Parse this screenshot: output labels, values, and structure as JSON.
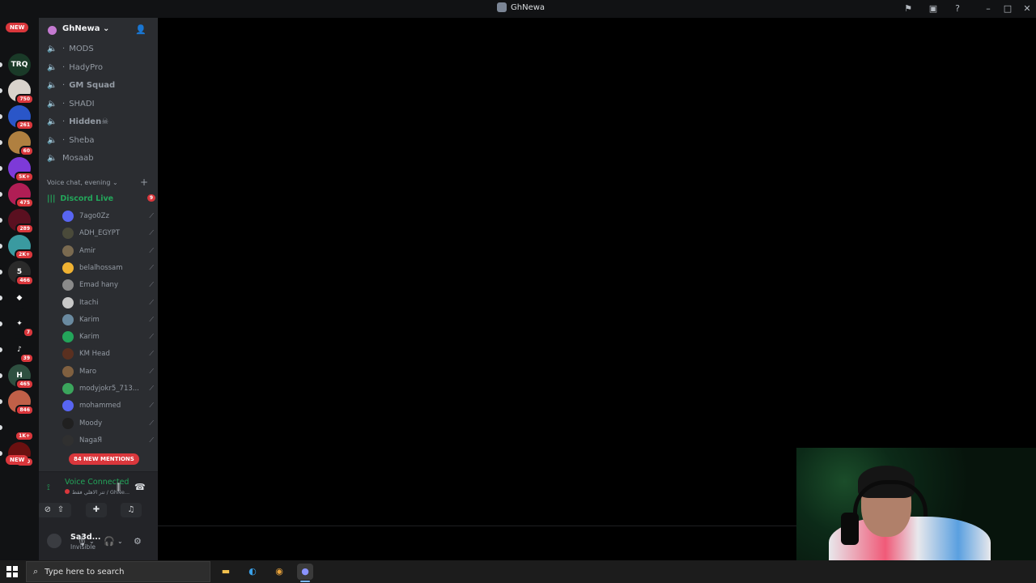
{
  "window": {
    "title": "GhNewa"
  },
  "rail": {
    "new_top": "NEW",
    "new_bottom": "NEW",
    "servers": [
      {
        "badge": "",
        "color": "#1a3a28",
        "glyph": "TRQ"
      },
      {
        "badge": "750",
        "color": "#d9d3cc",
        "glyph": ""
      },
      {
        "badge": "261",
        "color": "#2a56c8",
        "glyph": ""
      },
      {
        "badge": "60",
        "color": "#b08040",
        "glyph": ""
      },
      {
        "badge": "5K+",
        "color": "#7d3ad8",
        "glyph": ""
      },
      {
        "badge": "475",
        "color": "#b01e55",
        "glyph": ""
      },
      {
        "badge": "289",
        "color": "#5a1020",
        "glyph": ""
      },
      {
        "badge": "2K+",
        "color": "#3a9aa0",
        "glyph": ""
      },
      {
        "badge": "466",
        "color": "#2a2a2a",
        "glyph": "5"
      },
      {
        "badge": "",
        "color": "#111214",
        "glyph": "◆"
      },
      {
        "badge": "7",
        "color": "#111214",
        "glyph": "✦"
      },
      {
        "badge": "39",
        "color": "#111214",
        "glyph": "♪"
      },
      {
        "badge": "465",
        "color": "#2e5040",
        "glyph": "H"
      },
      {
        "badge": "846",
        "color": "#c06048",
        "glyph": ""
      },
      {
        "badge": "1K+",
        "color": "#111214",
        "glyph": ""
      },
      {
        "badge": "810",
        "color": "#6a1010",
        "glyph": ""
      }
    ]
  },
  "guild": {
    "name": "GhNewa"
  },
  "channels": [
    {
      "name": "MODS",
      "dot": true
    },
    {
      "name": "HadyPro",
      "dot": true
    },
    {
      "name": "GM Squad",
      "dot": true
    },
    {
      "name": "SHADI",
      "dot": true
    },
    {
      "name": "Hidden☠",
      "dot": true
    },
    {
      "name": "Sheba",
      "dot": true
    },
    {
      "name": "Mosaab",
      "dot": false
    }
  ],
  "category": {
    "name": "Voice chat, evening"
  },
  "live_channel": {
    "name": "Discord Live",
    "badge": "9"
  },
  "members": [
    {
      "name": "7ago0Zz",
      "color": "#5865f2"
    },
    {
      "name": "ADH_EGYPT",
      "color": "#4a4a3a"
    },
    {
      "name": "Amir",
      "color": "#7a6a50"
    },
    {
      "name": "belalhossam",
      "color": "#f0b232"
    },
    {
      "name": "Emad hany",
      "color": "#8a8a8a"
    },
    {
      "name": "Itachi",
      "color": "#c8c8c8"
    },
    {
      "name": "Karim",
      "color": "#6a8aa0"
    },
    {
      "name": "Karim",
      "color": "#23a55a"
    },
    {
      "name": "KM Head",
      "color": "#5a3020"
    },
    {
      "name": "Maro",
      "color": "#806040"
    },
    {
      "name": "modyjokr5_713...",
      "color": "#3ba55c"
    },
    {
      "name": "mohammed",
      "color": "#5865f2"
    },
    {
      "name": "Moody",
      "color": "#202020"
    },
    {
      "name": "NagaЯ",
      "color": "#303030"
    }
  ],
  "mentions": {
    "label": "84 NEW MENTIONS"
  },
  "voice": {
    "status": "Voice Connected",
    "subtitle": "تتر الاهلي فقط / GhNe..."
  },
  "user": {
    "name": "Sa3d...",
    "status": "Invisible"
  },
  "taskbar": {
    "search_placeholder": "Type here to search"
  },
  "icons": [
    "windows-start-icon",
    "search-icon",
    "file-explorer-icon",
    "edge-icon",
    "chrome-icon",
    "discord-icon",
    "inbox-icon",
    "settings-icon",
    "help-icon",
    "headphones-icon",
    "microphone-icon"
  ]
}
